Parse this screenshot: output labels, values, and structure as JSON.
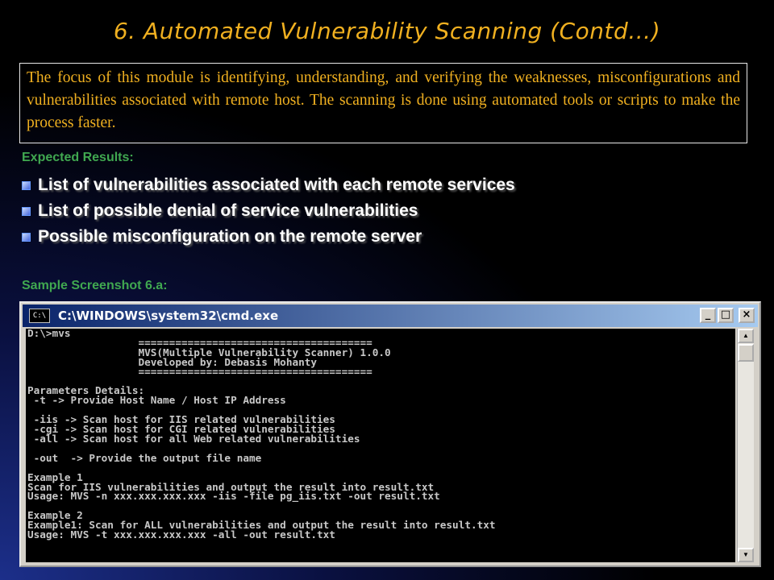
{
  "slide": {
    "title": "6. Automated Vulnerability Scanning (Contd…)",
    "intro": "The focus of this module is identifying, understanding, and verifying the weaknesses, misconfigurations and vulnerabilities associated with remote host. The scanning is done using automated tools or scripts to make the process faster.",
    "expected_heading": "Expected Results:",
    "results": [
      "List of vulnerabilities associated with each remote services",
      "List of possible denial of service vulnerabilities",
      "Possible misconfiguration on the remote server"
    ],
    "sample_heading": "Sample Screenshot 6.a:"
  },
  "window": {
    "title": "C:\\WINDOWS\\system32\\cmd.exe",
    "icon_label": "C:\\",
    "icon": "cmd-icon",
    "buttons": {
      "minimize": "_",
      "maximize": "□",
      "close": "×"
    },
    "console_text": "D:\\>mvs\n                  ======================================\n                  MVS(Multiple Vulnerability Scanner) 1.0.0\n                  Developed by: Debasis Mohanty\n                  ======================================\n\nParameters Details:\n -t -> Provide Host Name / Host IP Address\n\n -iis -> Scan host for IIS related vulnerabilities\n -cgi -> Scan host for CGI related vulnerabilities\n -all -> Scan host for all Web related vulnerabilities\n\n -out  -> Provide the output file name\n\nExample 1\nScan for IIS vulnerabilities and output the result into result.txt\nUsage: MVS -n xxx.xxx.xxx.xxx -iis -file pg_iis.txt -out result.txt\n\nExample 2\nExample1: Scan for ALL vulnerabilities and output the result into result.txt\nUsage: MVS -t xxx.xxx.xxx.xxx -all -out result.txt",
    "scroll_up": "▲",
    "scroll_down": "▼"
  },
  "colors": {
    "title": "#f0b020",
    "heading": "#40a850",
    "titlebar": "#0a246a"
  }
}
